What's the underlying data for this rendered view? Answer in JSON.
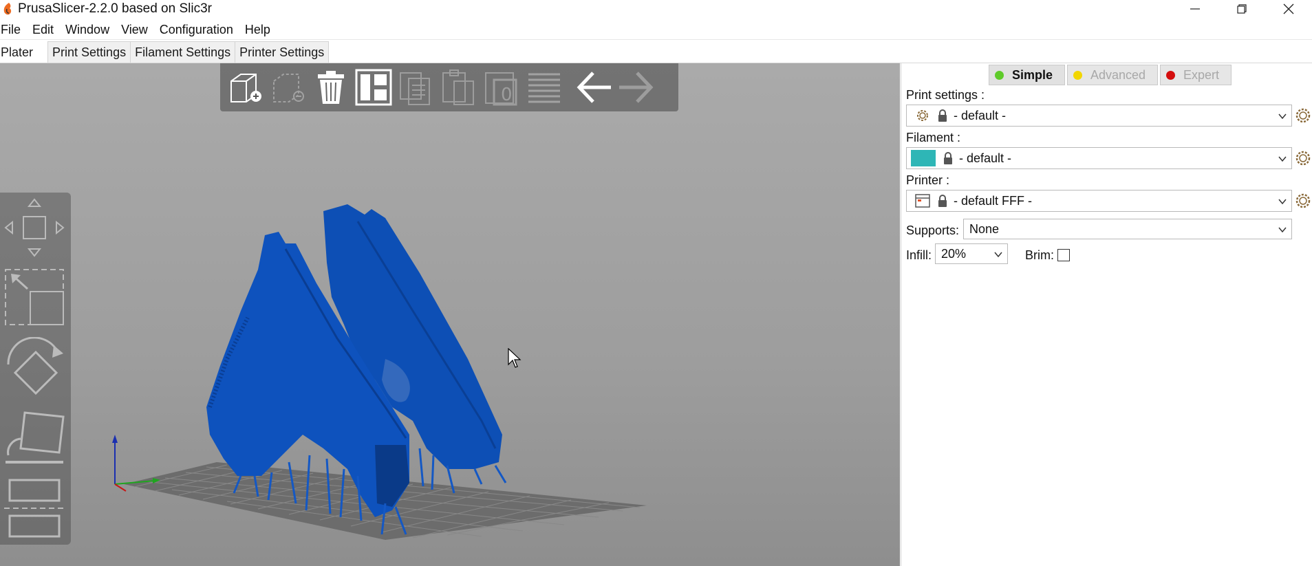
{
  "window": {
    "title": "PrusaSlicer-2.2.0 based on Slic3r"
  },
  "menu": [
    "File",
    "Edit",
    "Window",
    "View",
    "Configuration",
    "Help"
  ],
  "tabs": {
    "items": [
      "Plater",
      "Print Settings",
      "Filament Settings",
      "Printer Settings"
    ],
    "active": "Plater"
  },
  "toolbar_top": {
    "icons": [
      "add-icon",
      "delete-icon",
      "delete-all-icon",
      "arrange-icon",
      "copy-icon",
      "paste-icon",
      "instances-icon",
      "split-icon",
      "layers-icon",
      "undo-icon",
      "redo-icon"
    ]
  },
  "toolbar_left": {
    "icons": [
      "move-icon",
      "scale-icon",
      "rotate-icon",
      "place-on-face-icon",
      "cut-icon"
    ]
  },
  "sidebar": {
    "modes": {
      "simple": "Simple",
      "advanced": "Advanced",
      "expert": "Expert",
      "simple_color": "#5fcb2a",
      "advanced_color": "#f2d600",
      "expert_color": "#d40e0e"
    },
    "print_settings_label": "Print settings :",
    "print_settings_value": "- default -",
    "filament_label": "Filament :",
    "filament_value": "- default -",
    "filament_color": "#2eb6b6",
    "printer_label": "Printer :",
    "printer_value": "- default FFF -",
    "supports_label": "Supports:",
    "supports_value": "None",
    "infill_label": "Infill:",
    "infill_value": "20%",
    "brim_label": "Brim:",
    "brim_checked": false
  },
  "scene": {
    "model_color": "#0c4fb8",
    "bed_color": "#5a5a5a"
  }
}
